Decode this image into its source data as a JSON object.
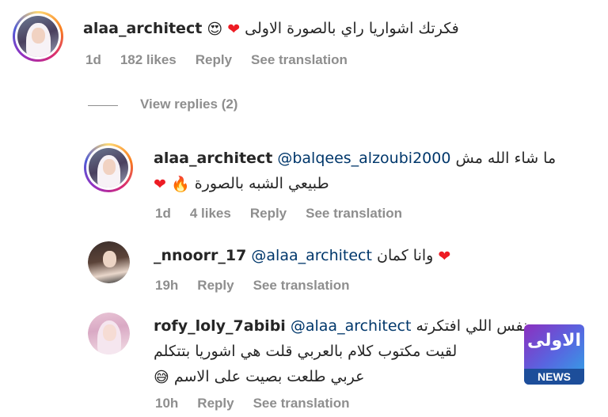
{
  "comments": [
    {
      "username": "alaa_architect",
      "text": "فكرتك اشواريا راي بالصورة الاولى",
      "emoji": [
        "😍",
        "❤"
      ],
      "meta": {
        "time": "1d",
        "likes": "182 likes",
        "reply": "Reply",
        "translate": "See translation"
      }
    }
  ],
  "view_replies": "View replies (2)",
  "replies": [
    {
      "username": "alaa_architect",
      "mention": "@balqees_alzoubi2000",
      "line1": "ما شاء الله مش",
      "line2": "طبيعي الشبه بالصورة",
      "emoji": [
        "❤",
        "🔥"
      ],
      "meta": {
        "time": "1d",
        "likes": "4 likes",
        "reply": "Reply",
        "translate": "See translation"
      }
    },
    {
      "username": "_nnoorr_17",
      "mention": "@alaa_architect",
      "line1": "وانا كمان",
      "emoji": [
        "❤"
      ],
      "meta": {
        "time": "19h",
        "reply": "Reply",
        "translate": "See translation"
      }
    },
    {
      "username": "rofy_loly_7abibi",
      "mention": "@alaa_architect",
      "line1": "نفس اللي افتكرته",
      "line2": "لقيت مكتوب كلام بالعربي قلت هي اشوريا بتتكلم",
      "line3": "عربي طلعت بصيت على الاسم",
      "emoji": [
        "😅"
      ],
      "meta": {
        "time": "10h",
        "reply": "Reply",
        "translate": "See translation"
      }
    }
  ],
  "watermark": {
    "mark": "الاولى",
    "label": "NEWS"
  }
}
